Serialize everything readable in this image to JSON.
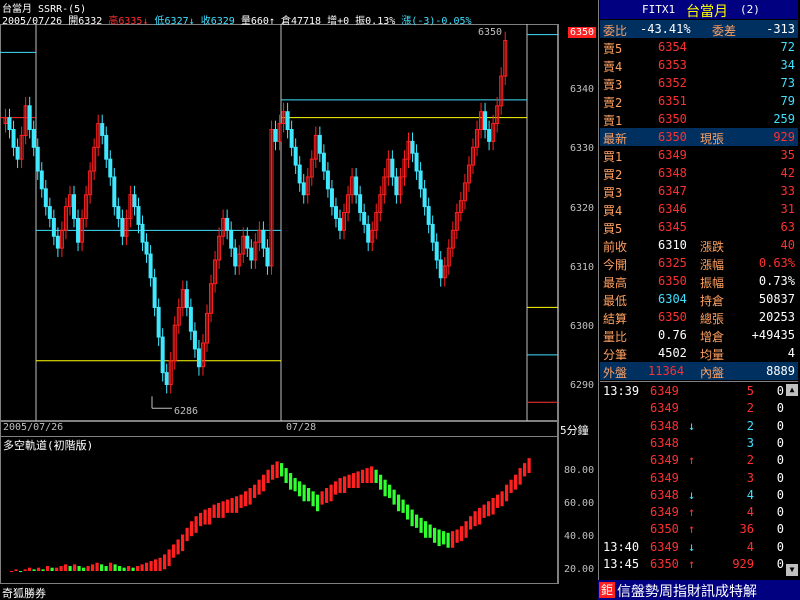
{
  "header": {
    "symbol": "台當月",
    "indicator": "SSRR-(5)",
    "date": "2005/07/26",
    "open_label": "開",
    "open": "6332",
    "high_label": "高",
    "high": "6335",
    "low_label": "低",
    "low": "6327",
    "close_label": "收",
    "close": "6329",
    "volume_label": "量",
    "volume": "660",
    "oi_label": "倉",
    "oi": "47718",
    "add_label": "增",
    "add": "+0",
    "amp_label": "振",
    "amp": "0.13%",
    "change_label": "漲",
    "change": "(-3)-0.05%"
  },
  "main_chart": {
    "price_ticks": [
      "6340",
      "6330",
      "6320",
      "6310",
      "6300",
      "6290"
    ],
    "current_price_tag": "6350",
    "high_marker": "6350",
    "low_marker": "6286",
    "date_left": "2005/07/26",
    "date_right": "07/28",
    "timeframe": "5分鐘"
  },
  "indicator_panel": {
    "title": "多空軌道(初階版)",
    "ticks": [
      "80.00",
      "60.00",
      "40.00",
      "20.00"
    ],
    "broker": "奇狐勝券"
  },
  "quote": {
    "code": "FITX1",
    "name": "台當月",
    "name_suffix": "(2)",
    "ratio_label": "委比",
    "ratio": "-43.41%",
    "diff_label": "委差",
    "diff": "-313",
    "asks": [
      {
        "label": "賣5",
        "price": "6354",
        "vol": "72"
      },
      {
        "label": "賣4",
        "price": "6353",
        "vol": "34"
      },
      {
        "label": "賣3",
        "price": "6352",
        "vol": "73"
      },
      {
        "label": "賣2",
        "price": "6351",
        "vol": "79"
      },
      {
        "label": "賣1",
        "price": "6350",
        "vol": "259"
      }
    ],
    "last_label": "最新",
    "last": "6350",
    "last_vol_label": "現張",
    "last_vol": "929",
    "bids": [
      {
        "label": "買1",
        "price": "6349",
        "vol": "35"
      },
      {
        "label": "買2",
        "price": "6348",
        "vol": "42"
      },
      {
        "label": "買3",
        "price": "6347",
        "vol": "33"
      },
      {
        "label": "買4",
        "price": "6346",
        "vol": "31"
      },
      {
        "label": "買5",
        "price": "6345",
        "vol": "63"
      }
    ],
    "stats": [
      {
        "l1": "前收",
        "v1": "6310",
        "c1": "white",
        "l2": "漲跌",
        "v2": "40",
        "c2": "red"
      },
      {
        "l1": "今開",
        "v1": "6325",
        "c1": "red",
        "l2": "漲幅",
        "v2": "0.63%",
        "c2": "red"
      },
      {
        "l1": "最高",
        "v1": "6350",
        "c1": "red",
        "l2": "振幅",
        "v2": "0.73%",
        "c2": "white"
      },
      {
        "l1": "最低",
        "v1": "6304",
        "c1": "cyan",
        "l2": "持倉",
        "v2": "50837",
        "c2": "white"
      },
      {
        "l1": "結算",
        "v1": "6350",
        "c1": "red",
        "l2": "總張",
        "v2": "20253",
        "c2": "white"
      },
      {
        "l1": "量比",
        "v1": "0.76",
        "c1": "white",
        "l2": "增倉",
        "v2": "+49435",
        "c2": "white"
      },
      {
        "l1": "分筆",
        "v1": "4502",
        "c1": "white",
        "l2": "均量",
        "v2": "4",
        "c2": "white"
      }
    ],
    "outer_label": "外盤",
    "outer": "11364",
    "inner_label": "內盤",
    "inner": "8889"
  },
  "ticks": [
    {
      "time": "13:39",
      "price": "6349",
      "arrow": "",
      "vol": "5",
      "x": "0",
      "pc": "red",
      "vc": "red"
    },
    {
      "time": "",
      "price": "6349",
      "arrow": "",
      "vol": "2",
      "x": "0",
      "pc": "red",
      "vc": "red"
    },
    {
      "time": "",
      "price": "6348",
      "arrow": "↓",
      "vol": "2",
      "x": "0",
      "pc": "red",
      "vc": "cyan"
    },
    {
      "time": "",
      "price": "6348",
      "arrow": "",
      "vol": "3",
      "x": "0",
      "pc": "red",
      "vc": "cyan"
    },
    {
      "time": "",
      "price": "6349",
      "arrow": "↑",
      "vol": "2",
      "x": "0",
      "pc": "red",
      "vc": "red"
    },
    {
      "time": "",
      "price": "6349",
      "arrow": "",
      "vol": "3",
      "x": "0",
      "pc": "red",
      "vc": "red"
    },
    {
      "time": "",
      "price": "6348",
      "arrow": "↓",
      "vol": "4",
      "x": "0",
      "pc": "red",
      "vc": "cyan"
    },
    {
      "time": "",
      "price": "6349",
      "arrow": "↑",
      "vol": "4",
      "x": "0",
      "pc": "red",
      "vc": "red"
    },
    {
      "time": "",
      "price": "6350",
      "arrow": "↑",
      "vol": "36",
      "x": "0",
      "pc": "red",
      "vc": "red"
    },
    {
      "time": "13:40",
      "price": "6349",
      "arrow": "↓",
      "vol": "4",
      "x": "0",
      "pc": "red",
      "vc": "red"
    },
    {
      "time": "13:45",
      "price": "6350",
      "arrow": "↑",
      "vol": "929",
      "x": "0",
      "pc": "red",
      "vc": "red"
    }
  ],
  "banner": "信盤勢周指財訊成特解",
  "colors": {
    "up": "#ff2020",
    "down": "#40e8ff",
    "bar_green": "#30ff30",
    "bar_red": "#ff2020",
    "grid": "#808080"
  }
}
